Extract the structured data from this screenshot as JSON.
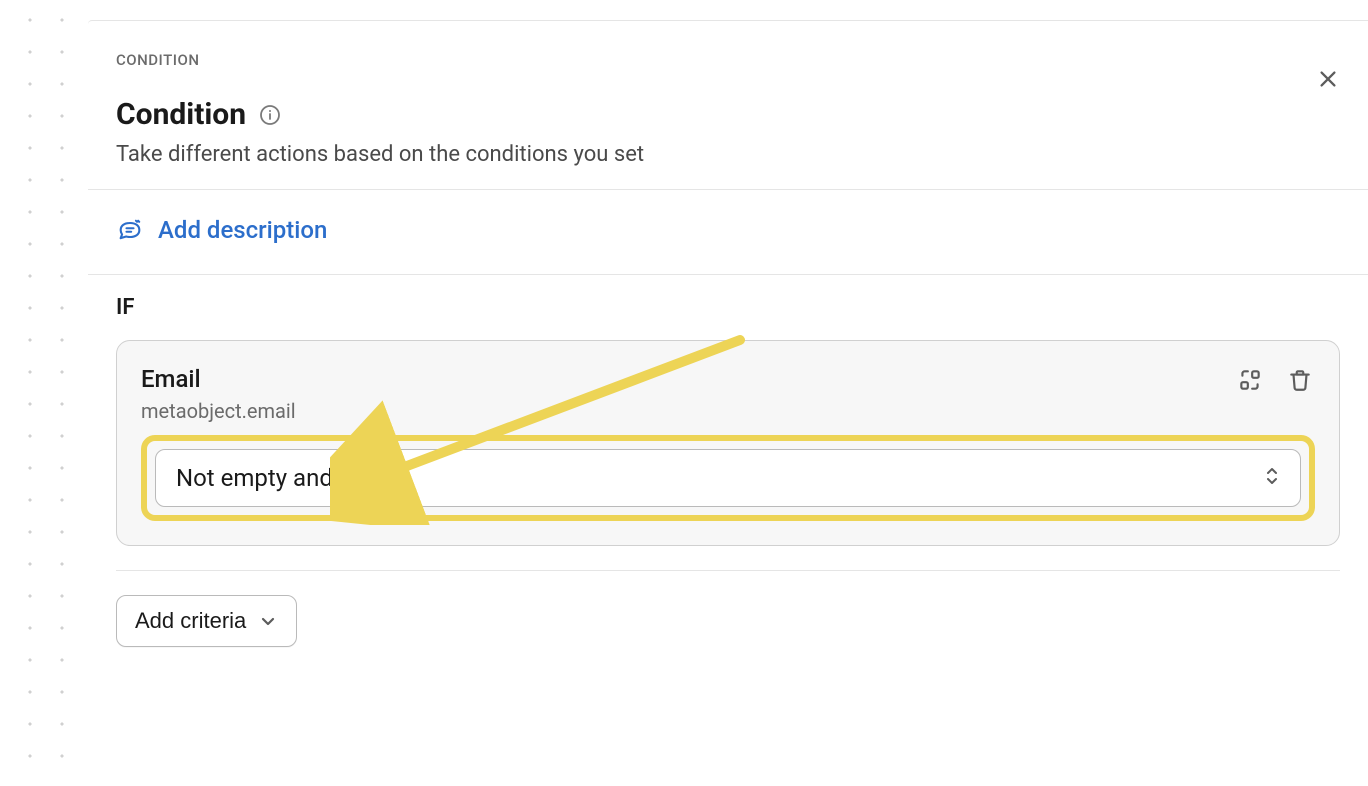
{
  "panel": {
    "label": "CONDITION",
    "title": "Condition",
    "subtitle": "Take different actions based on the conditions you set"
  },
  "actions": {
    "add_description": "Add description"
  },
  "condition": {
    "if_label": "IF",
    "criteria": {
      "field_label": "Email",
      "field_path": "metaobject.email",
      "operator_selected": "Not empty and exists"
    },
    "add_criteria_label": "Add criteria"
  },
  "annotation": {
    "highlight_color": "#edd456"
  }
}
